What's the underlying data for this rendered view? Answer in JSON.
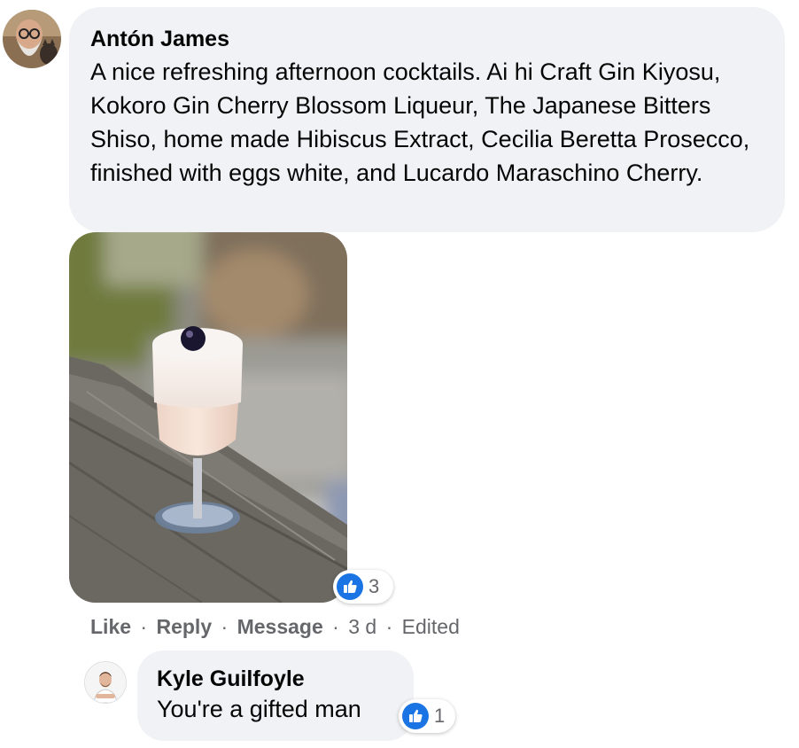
{
  "comment": {
    "author": "Antón James",
    "text": "A nice refreshing afternoon cocktails. Ai hi Craft Gin Kiyosu, Kokoro Gin Cherry Blossom Liqueur, The Japanese Bitters Shiso, home made Hibiscus Extract, Cecilia Beretta Prosecco, finished with eggs white, and Lucardo Maraschino Cherry.",
    "reaction": {
      "icon": "thumbs-up-icon",
      "count": "3"
    },
    "actions": {
      "like": "Like",
      "reply": "Reply",
      "message": "Message",
      "time": "3 d",
      "edited": "Edited",
      "separator": "·"
    }
  },
  "reply": {
    "author": "Kyle Guilfoyle",
    "text": "You're a gifted man",
    "reaction": {
      "icon": "thumbs-up-icon",
      "count": "1"
    }
  },
  "colors": {
    "bubble": "#f0f2f5",
    "like_blue": "#1b74e4",
    "secondary_text": "#65676b",
    "primary_text": "#050505"
  }
}
